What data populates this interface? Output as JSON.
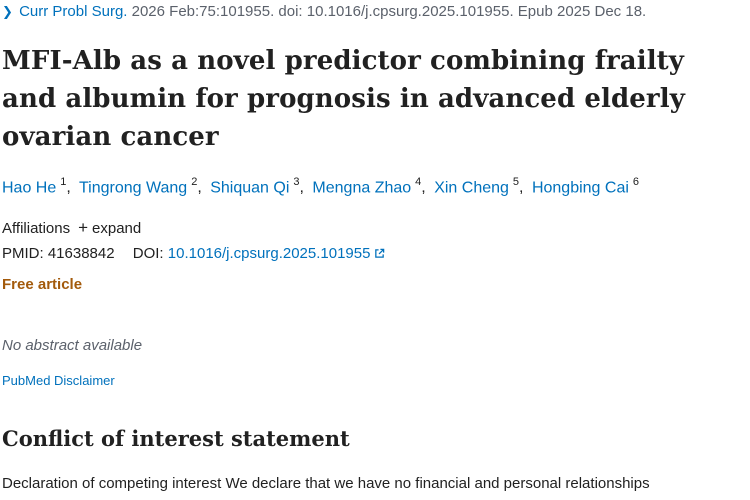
{
  "citation": {
    "journal": "Curr Probl Surg.",
    "details": "2026 Feb:75:101955. doi: 10.1016/j.cpsurg.2025.101955. Epub 2025 Dec 18."
  },
  "title": "MFI-Alb as a novel predictor combining frailty and albumin for prognosis in advanced elderly ovarian cancer",
  "authors": [
    {
      "name": "Hao He",
      "num": "1"
    },
    {
      "name": "Tingrong Wang",
      "num": "2"
    },
    {
      "name": "Shiquan Qi",
      "num": "3"
    },
    {
      "name": "Mengna Zhao",
      "num": "4"
    },
    {
      "name": "Xin Cheng",
      "num": "5"
    },
    {
      "name": "Hongbing Cai",
      "num": "6"
    }
  ],
  "affiliations": {
    "label": "Affiliations",
    "expand": "expand"
  },
  "ids": {
    "pmid_label": "PMID:",
    "pmid": "41638842",
    "doi_label": "DOI:",
    "doi": "10.1016/j.cpsurg.2025.101955"
  },
  "free_article": "Free article",
  "no_abstract": "No abstract available",
  "disclaimer": "PubMed Disclaimer",
  "coi": {
    "heading": "Conflict of interest statement",
    "text": "Declaration of competing interest We declare that we have no financial and personal relationships"
  }
}
